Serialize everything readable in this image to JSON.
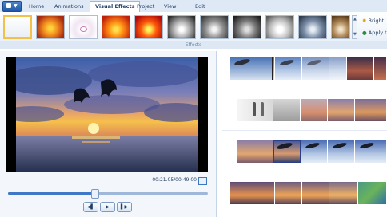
{
  "window": {
    "app_menu_arrow": "▼"
  },
  "tabs": [
    {
      "label": "Home"
    },
    {
      "label": "Animations"
    },
    {
      "label": "Visual Effects",
      "active": true
    },
    {
      "label": "Project"
    },
    {
      "label": "View"
    },
    {
      "label": "Edit"
    }
  ],
  "ribbon": {
    "group_label": "Effects",
    "brightness_label": "Bright",
    "apply_label": "Apply t",
    "effects_count": 12
  },
  "preview": {
    "timecode": "00:21.05/00:49.00",
    "progress_fraction": 0.43
  },
  "playback": {
    "prev": "◀▌",
    "play": "▶",
    "next": "▌▶"
  },
  "colors": {
    "accent": "#3e78c6",
    "ribbon_bg": "#e6eef8",
    "tab_bg": "#dfe9f5"
  }
}
